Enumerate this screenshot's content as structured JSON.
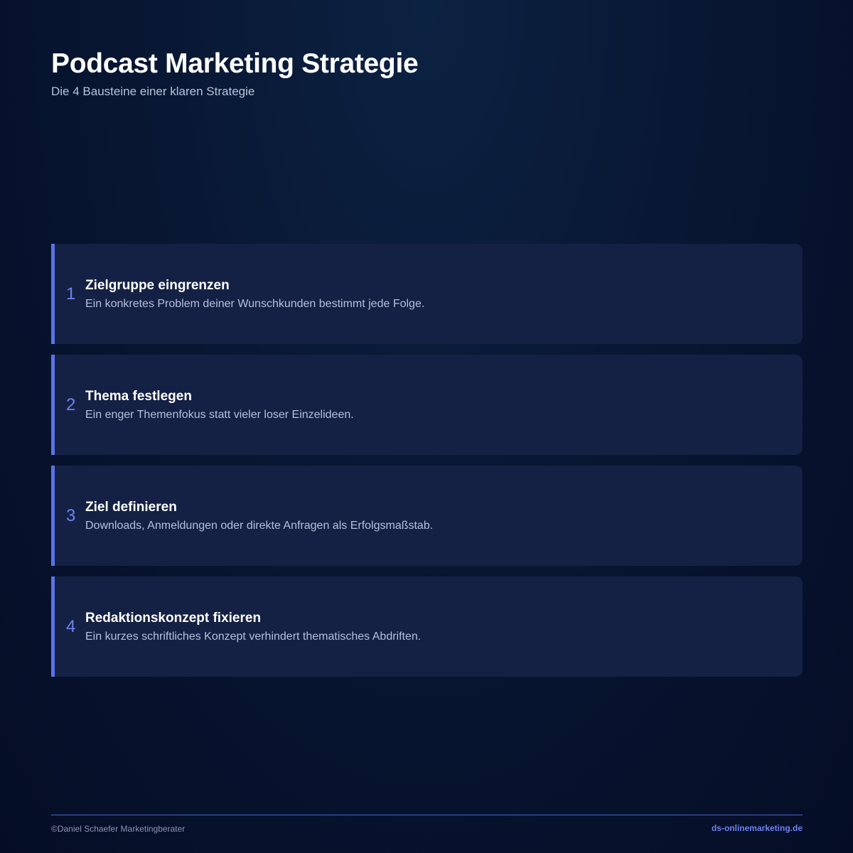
{
  "header": {
    "title": "Podcast Marketing Strategie",
    "subtitle": "Die 4 Bausteine einer klaren Strategie"
  },
  "cards": [
    {
      "number": "1",
      "title": "Zielgruppe eingrenzen",
      "description": "Ein konkretes Problem deiner Wunschkunden bestimmt jede Folge."
    },
    {
      "number": "2",
      "title": "Thema festlegen",
      "description": "Ein enger Themenfokus statt vieler loser Einzelideen."
    },
    {
      "number": "3",
      "title": "Ziel definieren",
      "description": "Downloads, Anmeldungen oder direkte Anfragen als Erfolgsmaßstab."
    },
    {
      "number": "4",
      "title": "Redaktionskonzept fixieren",
      "description": "Ein kurzes schriftliches Konzept verhindert thematisches Abdriften."
    }
  ],
  "footer": {
    "copyright": "©Daniel Schaefer Marketingberater",
    "website": "ds-onlinemarketing.de"
  },
  "colors": {
    "accent": "#5b73e6",
    "card_background": "#142144",
    "page_background": "#081733"
  }
}
